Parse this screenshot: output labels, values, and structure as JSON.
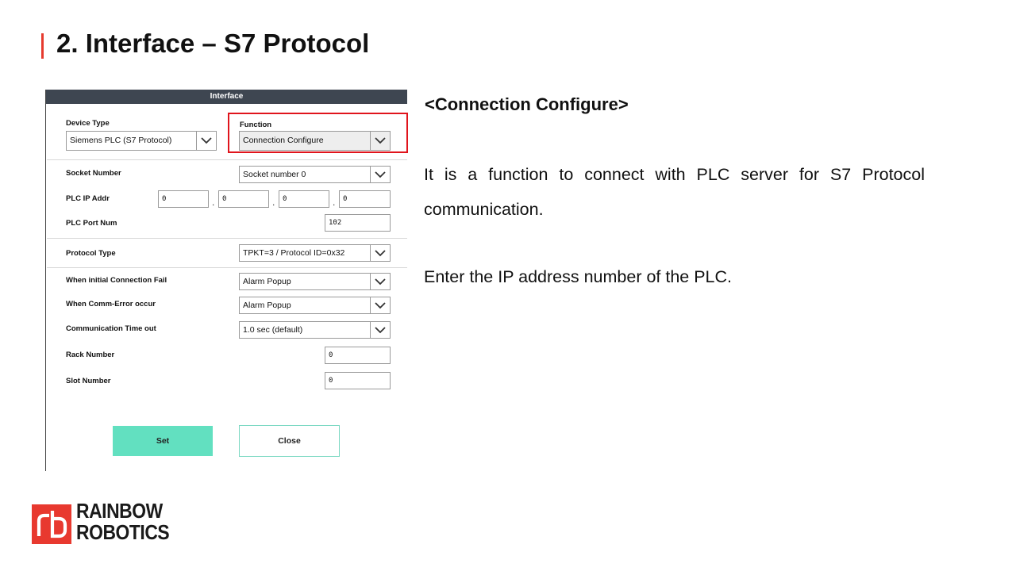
{
  "slide": {
    "title": "2. Interface – S7 Protocol",
    "accent_color": "#e63a2e"
  },
  "dialog": {
    "header": "Interface",
    "device_type": {
      "label": "Device Type",
      "value": "Siemens PLC (S7 Protocol)"
    },
    "function": {
      "label": "Function",
      "value": "Connection Configure"
    },
    "socket_number": {
      "label": "Socket Number",
      "value": "Socket number 0"
    },
    "plc_ip": {
      "label": "PLC IP Addr",
      "octets": [
        "0",
        "0",
        "0",
        "0"
      ],
      "separator": "."
    },
    "plc_port": {
      "label": "PLC Port Num",
      "value": "102"
    },
    "protocol_type": {
      "label": "Protocol Type",
      "value": "TPKT=3 / Protocol ID=0x32"
    },
    "initial_fail": {
      "label": "When initial Connection Fail",
      "value": "Alarm Popup"
    },
    "comm_error": {
      "label": "When Comm-Error occur",
      "value": "Alarm Popup"
    },
    "timeout": {
      "label": "Communication Time out",
      "value": "1.0 sec (default)"
    },
    "rack_number": {
      "label": "Rack Number",
      "value": "0"
    },
    "slot_number": {
      "label": "Slot Number",
      "value": "0"
    },
    "set_label": "Set",
    "close_label": "Close",
    "highlight_color": "#e0141c",
    "button_color": "#62e0c0"
  },
  "description": {
    "heading": "<Connection Configure>",
    "paragraph1": "It is a function to connect with PLC server for S7 Protocol communication.",
    "paragraph2": "Enter the IP address number of the PLC."
  },
  "logo": {
    "line1": "RAINBOW",
    "line2": "ROBOTICS",
    "color": "#e8392f"
  }
}
